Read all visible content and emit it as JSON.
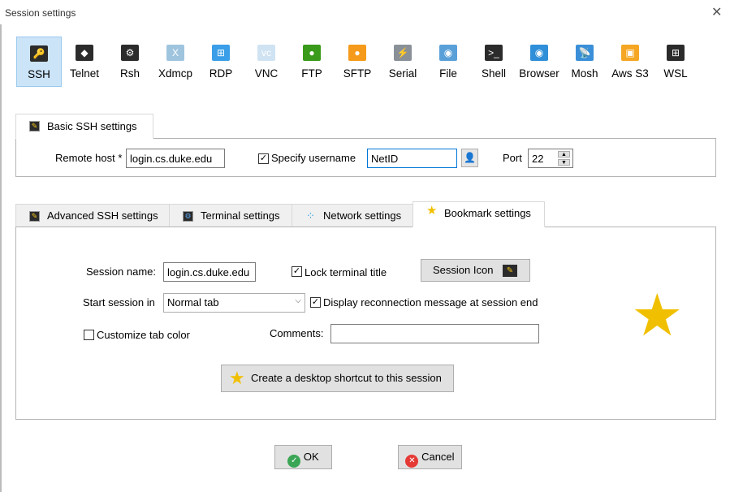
{
  "window": {
    "title": "Session settings",
    "close": "✕"
  },
  "session_types": [
    {
      "label": "SSH",
      "icon": "key-icon",
      "color": "#2b2b2b",
      "glyph": "🔑",
      "selected": true
    },
    {
      "label": "Telnet",
      "icon": "gem-icon",
      "color": "#2b2b2b",
      "glyph": "◆"
    },
    {
      "label": "Rsh",
      "icon": "gears-icon",
      "color": "#2b2b2b",
      "glyph": "⚙"
    },
    {
      "label": "Xdmcp",
      "icon": "x-monitor-icon",
      "color": "#9fc4de",
      "glyph": "X"
    },
    {
      "label": "RDP",
      "icon": "windows-monitor-icon",
      "color": "#3a9ee8",
      "glyph": "⊞"
    },
    {
      "label": "VNC",
      "icon": "vnc-monitor-icon",
      "color": "#cfe3f3",
      "glyph": "vc"
    },
    {
      "label": "FTP",
      "icon": "green-globe-icon",
      "color": "#3a9a1a",
      "glyph": "●"
    },
    {
      "label": "SFTP",
      "icon": "orange-globe-icon",
      "color": "#f59a1a",
      "glyph": "●"
    },
    {
      "label": "Serial",
      "icon": "plug-icon",
      "color": "#8a9098",
      "glyph": "⚡"
    },
    {
      "label": "File",
      "icon": "globe-monitor-icon",
      "color": "#5aa0d8",
      "glyph": "◉"
    },
    {
      "label": "Shell",
      "icon": "terminal-icon",
      "color": "#2b2b2b",
      "glyph": ">_"
    },
    {
      "label": "Browser",
      "icon": "earth-icon",
      "color": "#2f8fd8",
      "glyph": "◉"
    },
    {
      "label": "Mosh",
      "icon": "satellite-dish-icon",
      "color": "#3a8fd8",
      "glyph": "📡"
    },
    {
      "label": "Aws S3",
      "icon": "aws-cubes-icon",
      "color": "#f5a623",
      "glyph": "▣"
    },
    {
      "label": "WSL",
      "icon": "windows-icon",
      "color": "#2b2b2b",
      "glyph": "⊞"
    }
  ],
  "basic": {
    "tab": "Basic SSH settings",
    "remote_host_label": "Remote host *",
    "remote_host": "login.cs.duke.edu",
    "specify_username_label": "Specify username",
    "specify_username_checked": true,
    "username": "NetID",
    "port_label": "Port",
    "port": "22"
  },
  "tabs": [
    {
      "label": "Advanced SSH settings"
    },
    {
      "label": "Terminal settings"
    },
    {
      "label": "Network settings"
    },
    {
      "label": "Bookmark settings",
      "active": true
    }
  ],
  "bookmark": {
    "session_name_label": "Session name:",
    "session_name": "login.cs.duke.edu",
    "lock_title_label": "Lock terminal title",
    "lock_title_checked": true,
    "session_icon_label": "Session Icon",
    "start_in_label": "Start session in",
    "start_in": "Normal tab",
    "reconnect_label": "Display reconnection message at session end",
    "reconnect_checked": true,
    "custom_color_label": "Customize tab color",
    "custom_color_checked": false,
    "comments_label": "Comments:",
    "comments": "",
    "shortcut_label": "Create a desktop shortcut to this session",
    "star_color": "#f0c000"
  },
  "buttons": {
    "ok": "OK",
    "cancel": "Cancel"
  }
}
